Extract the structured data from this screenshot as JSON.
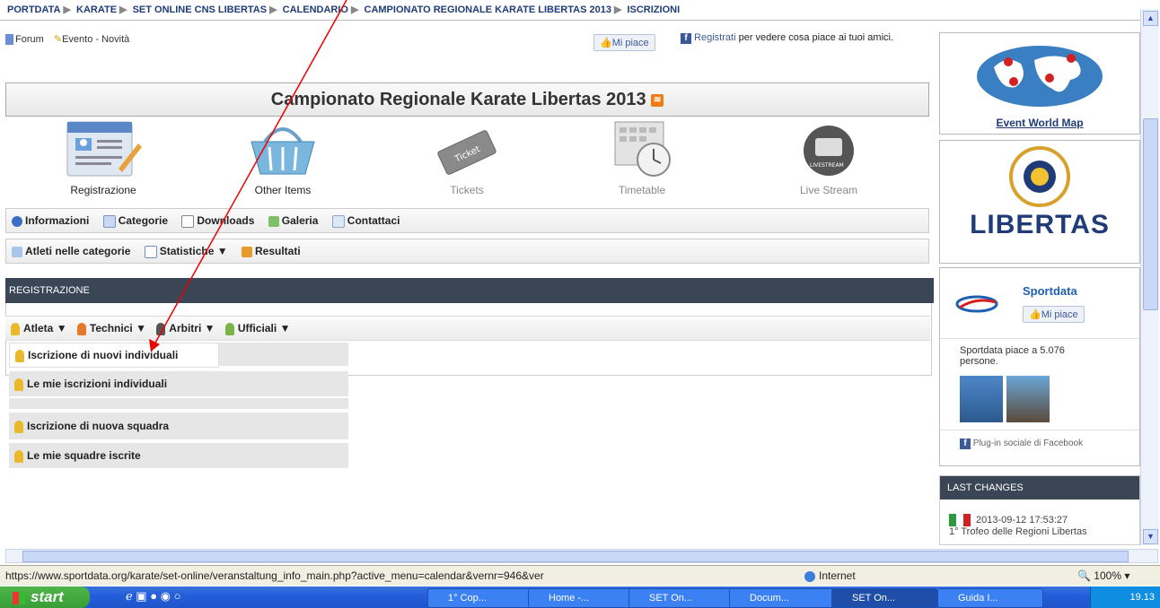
{
  "breadcrumb": [
    "PORTDATA",
    "KARATE",
    "SET ONLINE CNS LIBERTAS",
    "CALENDARIO",
    "CAMPIONATO REGIONALE KARATE LIBERTAS 2013",
    "ISCRIZIONI"
  ],
  "topbar": {
    "forum": "Forum",
    "evento": "Evento - Novità",
    "like": "Mi piace",
    "fb_register": "Registrati",
    "fb_text": "per vedere cosa piace ai tuoi amici."
  },
  "title": "Campionato Regionale Karate Libertas 2013",
  "tiles": [
    {
      "label": "Registrazione"
    },
    {
      "label": "Other Items"
    },
    {
      "label": "Tickets"
    },
    {
      "label": "Timetable"
    },
    {
      "label": "Live Stream"
    }
  ],
  "livestream_text": "LIVESTREAM",
  "ticket_text": "Ticket",
  "menu1": [
    "Informazioni",
    "Categorie",
    "Downloads",
    "Galeria",
    "Contattaci"
  ],
  "menu2": [
    "Atleti nelle categorie",
    "Statistiche",
    "Resultati"
  ],
  "section_header": "REGISTRAZIONE",
  "submenu": [
    "Atleta",
    "Technici",
    "Arbitri",
    "Ufficiali"
  ],
  "dropdown": [
    "Iscrizione di nuovi individuali",
    "Le mie iscrizioni individuali",
    "Iscrizione di nuova squadra",
    "Le mie squadre iscrite"
  ],
  "sidebar": {
    "event_map": "Event World Map",
    "libertas": "LIBERTAS",
    "sportdata": "Sportdata",
    "like": "Mi piace",
    "likes_text": "Sportdata piace a 5.076 persone.",
    "plugin": "Plug-in sociale di Facebook",
    "last_changes": "LAST CHANGES",
    "last_date": "2013-09-12 17:53:27",
    "last_item": "1° Trofeo delle Regioni Libertas"
  },
  "status": {
    "url": "https://www.sportdata.org/karate/set-online/veranstaltung_info_main.php?active_menu=calendar&vernr=946&ver",
    "zone": "Internet",
    "zoom": "100%"
  },
  "taskbar": {
    "start": "start",
    "tasks": [
      "1° Cop...",
      "Home -...",
      "SET On...",
      "Docum...",
      "SET On...",
      "Guida I..."
    ],
    "time": "19.13"
  },
  "colors": {
    "header": "#3a4556",
    "link": "#1f3c78",
    "taskbar": "#245edb"
  }
}
